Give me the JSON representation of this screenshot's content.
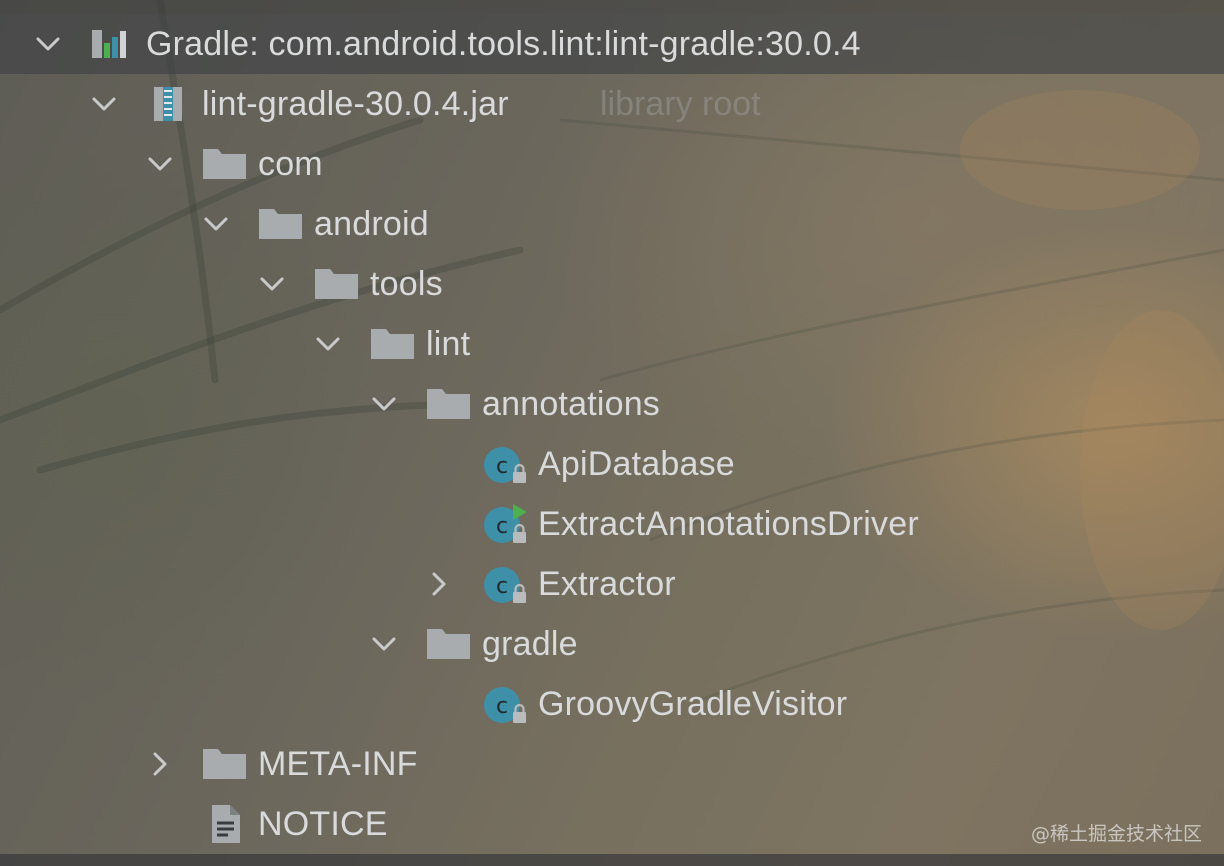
{
  "tree": {
    "gradle_root": {
      "label": "Gradle: com.android.tools.lint:lint-gradle:30.0.4",
      "icon": "gradle-library-icon",
      "expanded": true
    },
    "jar": {
      "label": "lint-gradle-30.0.4.jar",
      "hint": "library root",
      "icon": "jar-archive-icon",
      "expanded": true
    },
    "com": {
      "label": "com",
      "icon": "folder-icon",
      "expanded": true
    },
    "android": {
      "label": "android",
      "icon": "folder-icon",
      "expanded": true
    },
    "tools": {
      "label": "tools",
      "icon": "folder-icon",
      "expanded": true
    },
    "lint": {
      "label": "lint",
      "icon": "folder-icon",
      "expanded": true
    },
    "annotations": {
      "label": "annotations",
      "icon": "folder-icon",
      "expanded": true
    },
    "api_database": {
      "label": "ApiDatabase",
      "icon": "class-icon"
    },
    "extract_driver": {
      "label": "ExtractAnnotationsDriver",
      "icon": "runnable-class-icon"
    },
    "extractor": {
      "label": "Extractor",
      "icon": "class-icon",
      "expanded": false
    },
    "gradle": {
      "label": "gradle",
      "icon": "folder-icon",
      "expanded": true
    },
    "groovy_visitor": {
      "label": "GroovyGradleVisitor",
      "icon": "class-icon"
    },
    "meta_inf": {
      "label": "META-INF",
      "icon": "folder-icon",
      "expanded": false
    },
    "notice": {
      "label": "NOTICE",
      "icon": "text-file-icon"
    }
  },
  "watermark": "@稀土掘金技术社区",
  "colors": {
    "class_icon": "#3e8fa8",
    "folder_icon": "#a8acaf",
    "run_marker": "#4caf50",
    "text": "#d9dadb",
    "hint": "#8f918c"
  }
}
